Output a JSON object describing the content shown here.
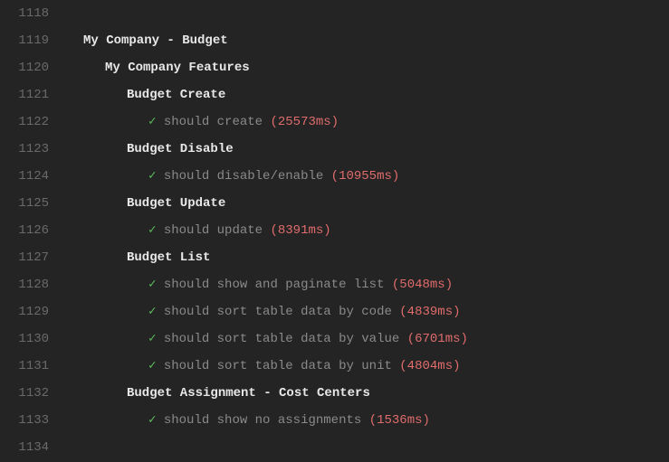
{
  "first_line_number": 1118,
  "check_glyph": "✓",
  "rows": [
    {
      "type": "blank"
    },
    {
      "type": "suite",
      "indent": 1,
      "label": "My Company - Budget"
    },
    {
      "type": "suite",
      "indent": 2,
      "label": "My Company Features"
    },
    {
      "type": "suite",
      "indent": 3,
      "label": "Budget Create"
    },
    {
      "type": "test",
      "indent": 4,
      "label": "should create",
      "duration": "(25573ms)"
    },
    {
      "type": "suite",
      "indent": 3,
      "label": "Budget Disable"
    },
    {
      "type": "test",
      "indent": 4,
      "label": "should disable/enable",
      "duration": "(10955ms)"
    },
    {
      "type": "suite",
      "indent": 3,
      "label": "Budget Update"
    },
    {
      "type": "test",
      "indent": 4,
      "label": "should update",
      "duration": "(8391ms)"
    },
    {
      "type": "suite",
      "indent": 3,
      "label": "Budget List"
    },
    {
      "type": "test",
      "indent": 4,
      "label": "should show and paginate list",
      "duration": "(5048ms)"
    },
    {
      "type": "test",
      "indent": 4,
      "label": "should sort table data by code",
      "duration": "(4839ms)"
    },
    {
      "type": "test",
      "indent": 4,
      "label": "should sort table data by value",
      "duration": "(6701ms)"
    },
    {
      "type": "test",
      "indent": 4,
      "label": "should sort table data by unit",
      "duration": "(4804ms)"
    },
    {
      "type": "suite",
      "indent": 3,
      "label": "Budget Assignment - Cost Centers"
    },
    {
      "type": "test",
      "indent": 4,
      "label": "should show no assignments",
      "duration": "(1536ms)"
    },
    {
      "type": "blank"
    }
  ]
}
